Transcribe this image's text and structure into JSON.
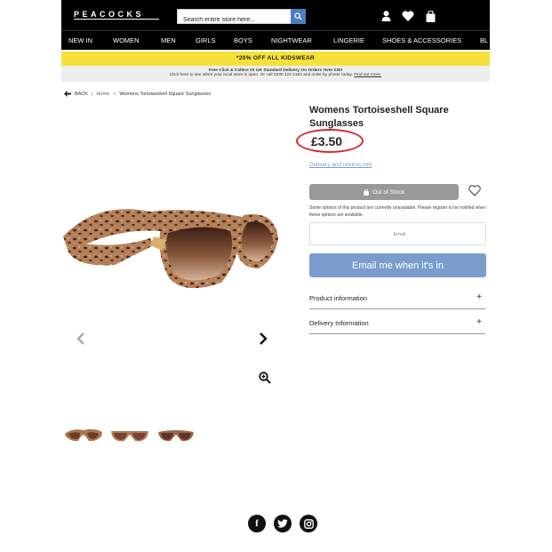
{
  "header": {
    "logo": "PEACOCKS",
    "search_placeholder": "Search entire store here...",
    "icons": [
      "user-icon",
      "heart-icon",
      "bag-icon"
    ]
  },
  "nav": {
    "items": [
      "NEW IN",
      "WOMEN",
      "MEN",
      "GIRLS",
      "BOYS",
      "NIGHTWEAR",
      "LINGERIE",
      "SHOES & ACCESSORIES",
      "BL"
    ]
  },
  "promo": {
    "text": "*20% OFF ALL KIDSWEAR"
  },
  "delivery_banner": {
    "line1": "Free Click & Collect Or UK Standard Delivery On Orders Over £30!",
    "line2": "Click here to see when your local store is open. Or call 0330 124 2184 and order by phone today.",
    "link": "Find out more."
  },
  "breadcrumb": {
    "back": "BACK",
    "separator": "|",
    "home": "Home",
    "arrow": ">",
    "current": "Womens Tortoiseshell Square Sunglasses"
  },
  "product": {
    "title": "Womens Tortoiseshell Square Sunglasses",
    "price": "£3.50",
    "delivery_link": "Delivery and returns info",
    "out_of_stock_label": "Out of Stock",
    "unavailable_note": "Some options of this product are currently unavailable. Please register to be notified when these options are available.",
    "email_placeholder": "Email",
    "email_button": "Email me when it's in",
    "accordions": [
      {
        "label": "Product information",
        "icon": "+"
      },
      {
        "label": "Delivery Information",
        "icon": "+"
      }
    ]
  },
  "colors": {
    "header_bg": "#000000",
    "promo_bg": "#f5e13a",
    "accent_blue": "#7b9dcd",
    "search_btn": "#4a7fc1",
    "price_circle": "#d42a2a",
    "oos_grey": "#999999"
  },
  "social": [
    "facebook-icon",
    "twitter-icon",
    "instagram-icon"
  ]
}
